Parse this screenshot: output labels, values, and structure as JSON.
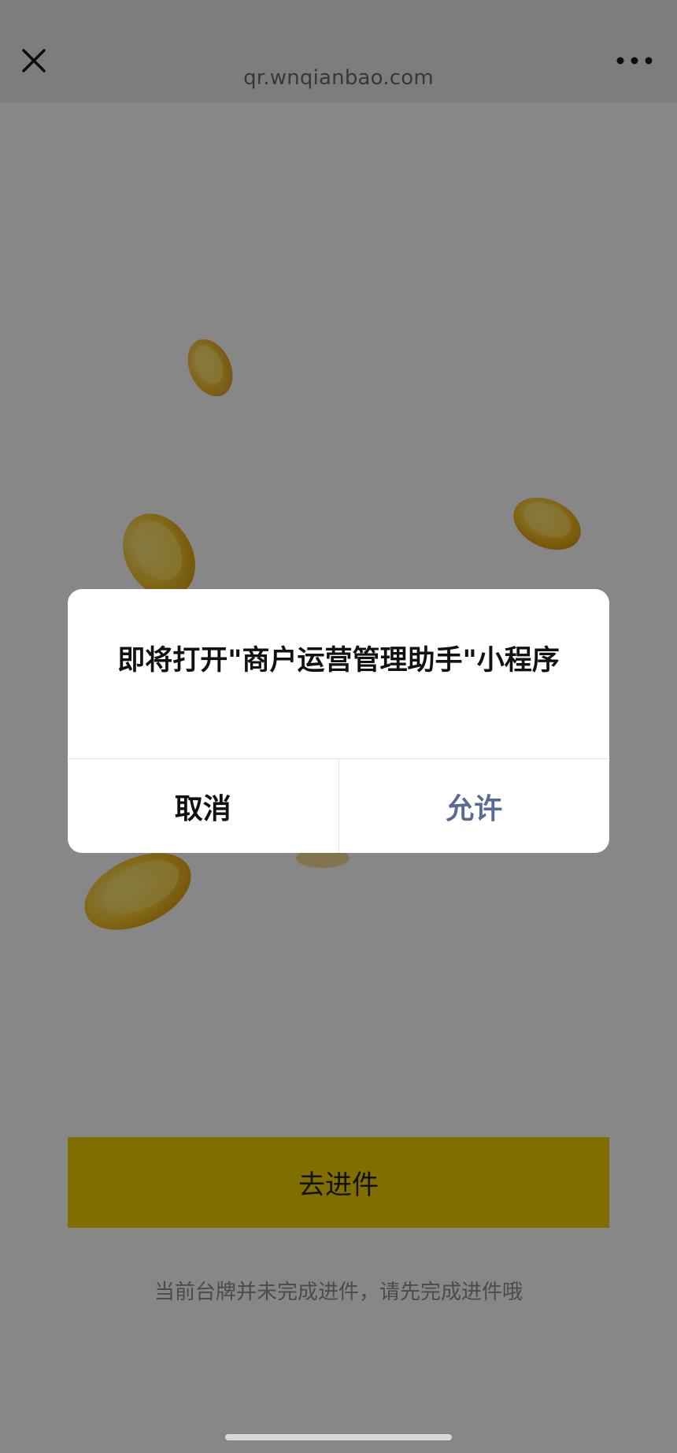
{
  "browser": {
    "url": "qr.wnqianbao.com",
    "close_icon": "close-icon",
    "more_icon": "more-icon"
  },
  "main": {
    "primary_button": "去进件",
    "hint": "当前台牌并未完成进件，请先完成进件哦",
    "accent_color": "#f3d003"
  },
  "dialog": {
    "title": "即将打开\"商户运营管理助手\"小程序",
    "cancel_label": "取消",
    "allow_label": "允许",
    "allow_color": "#576b95"
  }
}
